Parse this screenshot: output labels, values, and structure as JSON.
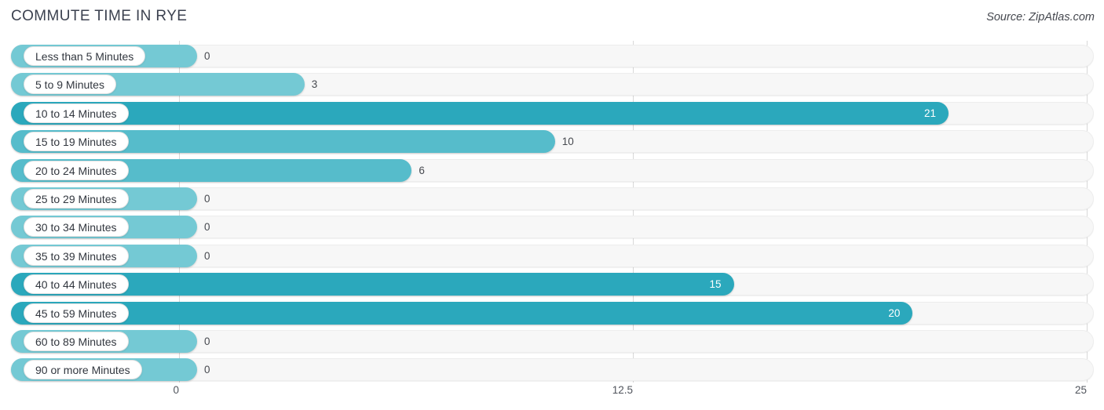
{
  "header": {
    "title": "COMMUTE TIME IN RYE",
    "source": "Source: ZipAtlas.com"
  },
  "axis": {
    "ticks": [
      "0",
      "12.5",
      "25"
    ],
    "tick_values": [
      0,
      12.5,
      25
    ]
  },
  "colors": {
    "bar_dark": "#2ba8bc",
    "bar_light": "#74c9d4",
    "bar_mid": "#56bccb",
    "track": "#f7f7f7",
    "gridline": "#d8d8d8",
    "title_text": "#3c4250"
  },
  "chart_data": {
    "type": "bar",
    "orientation": "horizontal",
    "title": "COMMUTE TIME IN RYE",
    "xlabel": "",
    "ylabel": "",
    "xlim": [
      0,
      25
    ],
    "grid": true,
    "legend": "none",
    "categories": [
      "Less than 5 Minutes",
      "5 to 9 Minutes",
      "10 to 14 Minutes",
      "15 to 19 Minutes",
      "20 to 24 Minutes",
      "25 to 29 Minutes",
      "30 to 34 Minutes",
      "35 to 39 Minutes",
      "40 to 44 Minutes",
      "45 to 59 Minutes",
      "60 to 89 Minutes",
      "90 or more Minutes"
    ],
    "values": [
      0,
      3,
      21,
      10,
      6,
      0,
      0,
      0,
      15,
      20,
      0,
      0
    ],
    "value_labels": [
      "0",
      "3",
      "21",
      "10",
      "6",
      "0",
      "0",
      "0",
      "15",
      "20",
      "0",
      "0"
    ]
  }
}
